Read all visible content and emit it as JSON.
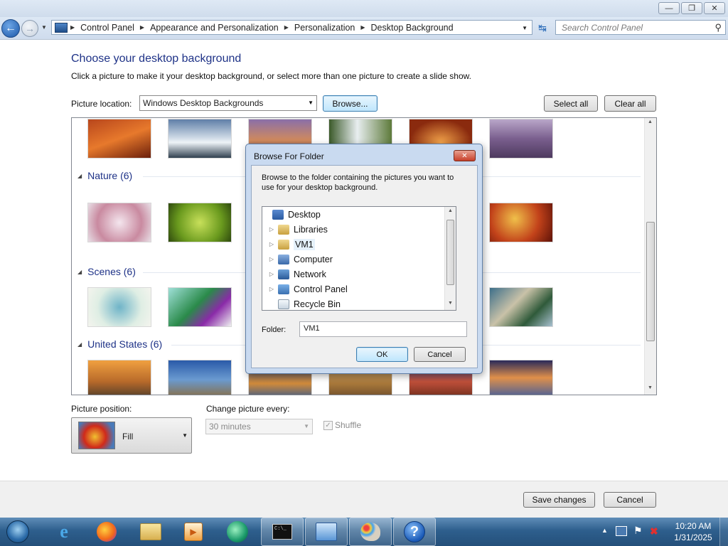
{
  "window": {
    "minimize_icon": "minimize-icon",
    "restore_icon": "restore-icon",
    "close_icon": "close-icon"
  },
  "address": {
    "crumbs": [
      "Control Panel",
      "Appearance and Personalization",
      "Personalization",
      "Desktop Background"
    ],
    "search_placeholder": "Search Control Panel"
  },
  "page": {
    "title": "Choose your desktop background",
    "description": "Click a picture to make it your desktop background, or select more than one picture to create a slide show.",
    "picture_location_label": "Picture location:",
    "picture_location_value": "Windows Desktop Backgrounds",
    "browse_label": "Browse...",
    "select_all_label": "Select all",
    "clear_all_label": "Clear all"
  },
  "gallery": {
    "groups": [
      "Nature (6)",
      "Scenes (6)",
      "United States (6)"
    ]
  },
  "dialog": {
    "title": "Browse For Folder",
    "instructions": "Browse to the folder containing the pictures you want to use for your desktop background.",
    "tree": [
      {
        "label": "Desktop",
        "icon": "desktop-icon"
      },
      {
        "label": "Libraries",
        "icon": "libraries-icon"
      },
      {
        "label": "VM1",
        "icon": "user-folder-icon"
      },
      {
        "label": "Computer",
        "icon": "computer-icon"
      },
      {
        "label": "Network",
        "icon": "network-icon"
      },
      {
        "label": "Control Panel",
        "icon": "control-panel-icon"
      },
      {
        "label": "Recycle Bin",
        "icon": "recycle-bin-icon"
      }
    ],
    "folder_label": "Folder:",
    "folder_value": "VM1",
    "ok_label": "OK",
    "cancel_label": "Cancel"
  },
  "options": {
    "picture_position_label": "Picture position:",
    "picture_position_value": "Fill",
    "change_every_label": "Change picture every:",
    "change_every_value": "30 minutes",
    "shuffle_label": "Shuffle"
  },
  "footer": {
    "save_label": "Save changes",
    "cancel_label": "Cancel"
  },
  "taskbar": {
    "apps": [
      "internet-explorer-icon",
      "firefox-icon",
      "file-explorer-icon",
      "media-player-icon",
      "media-center-icon",
      "command-prompt-icon",
      "control-panel-icon",
      "paint-icon",
      "help-icon"
    ],
    "time": "10:20 AM",
    "date": "1/31/2025"
  }
}
